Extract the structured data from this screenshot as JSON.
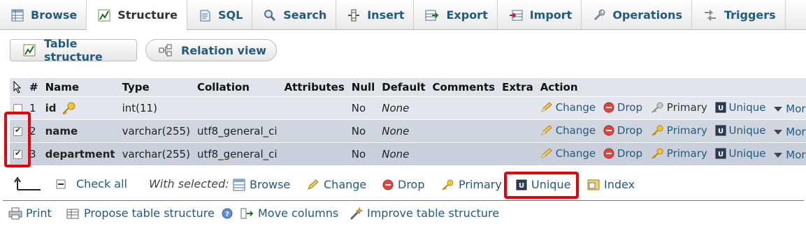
{
  "tabs": [
    {
      "label": "Browse",
      "icon": "browse-icon"
    },
    {
      "label": "Structure",
      "icon": "structure-icon",
      "active": true
    },
    {
      "label": "SQL",
      "icon": "sql-icon"
    },
    {
      "label": "Search",
      "icon": "search-icon"
    },
    {
      "label": "Insert",
      "icon": "insert-icon"
    },
    {
      "label": "Export",
      "icon": "export-icon"
    },
    {
      "label": "Import",
      "icon": "import-icon"
    },
    {
      "label": "Operations",
      "icon": "wrench-icon"
    },
    {
      "label": "Triggers",
      "icon": "triggers-icon"
    }
  ],
  "subnav": {
    "table_structure": "Table structure",
    "relation_view": "Relation view"
  },
  "table": {
    "headers": [
      "#",
      "Name",
      "Type",
      "Collation",
      "Attributes",
      "Null",
      "Default",
      "Comments",
      "Extra",
      "Action"
    ],
    "rows": [
      {
        "num": "1",
        "name": "id",
        "type": "int(11)",
        "collation": "",
        "attributes": "",
        "null": "No",
        "default": "None",
        "comments": "",
        "extra": "",
        "checked": false,
        "is_primary": true
      },
      {
        "num": "2",
        "name": "name",
        "type": "varchar(255)",
        "collation": "utf8_general_ci",
        "attributes": "",
        "null": "No",
        "default": "None",
        "comments": "",
        "extra": "",
        "checked": true,
        "is_primary": false
      },
      {
        "num": "3",
        "name": "department",
        "type": "varchar(255)",
        "collation": "utf8_general_ci",
        "attributes": "",
        "null": "No",
        "default": "None",
        "comments": "",
        "extra": "",
        "checked": true,
        "is_primary": false
      }
    ],
    "actions": {
      "change": "Change",
      "drop": "Drop",
      "primary": "Primary",
      "unique": "Unique",
      "more": "More"
    }
  },
  "bulk": {
    "check_all": "Check all",
    "with_selected": "With selected:",
    "browse": "Browse",
    "change": "Change",
    "drop": "Drop",
    "primary": "Primary",
    "unique": "Unique",
    "index": "Index"
  },
  "tools": {
    "print": "Print",
    "propose": "Propose table structure",
    "move_columns": "Move columns",
    "improve": "Improve table structure"
  },
  "colors": {
    "link": "#235a81",
    "highlight": "#e8000b",
    "header_bg": "#dfe3ea"
  }
}
